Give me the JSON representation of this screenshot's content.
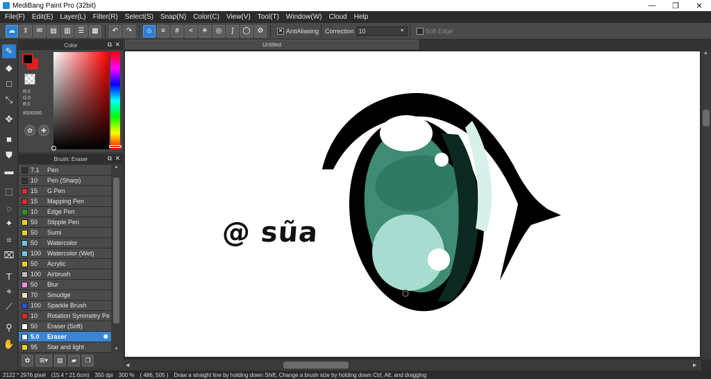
{
  "window": {
    "title": "MediBang Paint Pro (32bit)",
    "minimize": "—",
    "maximize": "❐",
    "close": "✕"
  },
  "menu": [
    "File(F)",
    "Edit(E)",
    "Layer(L)",
    "Filter(R)",
    "Select(S)",
    "Snap(N)",
    "Color(C)",
    "View(V)",
    "Tool(T)",
    "Window(W)",
    "Cloud",
    "Help"
  ],
  "toolbar": {
    "antialiasing_label": "AntiAliasing",
    "antialiasing_checked": "✕",
    "correction_label": "Correction",
    "correction_value": "10",
    "soft_edge_label": "Soft Edge"
  },
  "color_panel": {
    "title": "Color",
    "r": "R:0",
    "g": "G:0",
    "b": "B:0",
    "hex": "#000000",
    "foreground": "#000000",
    "background": "#e02020"
  },
  "brush_panel": {
    "title": "Brush: Eraser",
    "brushes": [
      {
        "size": "7.1",
        "name": "Pen",
        "color": "#333333"
      },
      {
        "size": "10",
        "name": "Pen (Sharp)",
        "color": "#333333"
      },
      {
        "size": "15",
        "name": "G Pen",
        "color": "#e02828"
      },
      {
        "size": "15",
        "name": "Mapping Pen",
        "color": "#e02828"
      },
      {
        "size": "10",
        "name": "Edge Pen",
        "color": "#22a022"
      },
      {
        "size": "50",
        "name": "Stipple Pen",
        "color": "#e8d020"
      },
      {
        "size": "50",
        "name": "Sumi",
        "color": "#e8d020"
      },
      {
        "size": "50",
        "name": "Watercolor",
        "color": "#70c8e8"
      },
      {
        "size": "100",
        "name": "Watercolor (Wet)",
        "color": "#70c8e8"
      },
      {
        "size": "50",
        "name": "Acrylic",
        "color": "#e8d020"
      },
      {
        "size": "100",
        "name": "Airbrush",
        "color": "#bbbbbb"
      },
      {
        "size": "50",
        "name": "Blur",
        "color": "#f090e0"
      },
      {
        "size": "70",
        "name": "Smudge",
        "color": "#f8d8c0"
      },
      {
        "size": "100",
        "name": "Sparkle Brush",
        "color": "#3050e0"
      },
      {
        "size": "10",
        "name": "Rotation Symmetry Pe",
        "color": "#e02828"
      },
      {
        "size": "50",
        "name": "Eraser (Soft)",
        "color": "#ffffff"
      },
      {
        "size": "5.0",
        "name": "Eraser",
        "color": "#ffffff",
        "active": true
      },
      {
        "size": "95",
        "name": "Star and light",
        "color": "#e8d020"
      }
    ]
  },
  "document": {
    "tab_title": "Untitled",
    "watermark": "@ sũa"
  },
  "status": {
    "pixel_size": "2122 * 2976 pixel",
    "physical_size": "(15.4 * 21.6cm)",
    "dpi": "350 dpi",
    "zoom": "300 %",
    "cursor": "( 486, 505 )",
    "hint": "Draw a straight line by holding down Shift, Change a brush size by holding down Ctrl, Alt, and dragging"
  }
}
